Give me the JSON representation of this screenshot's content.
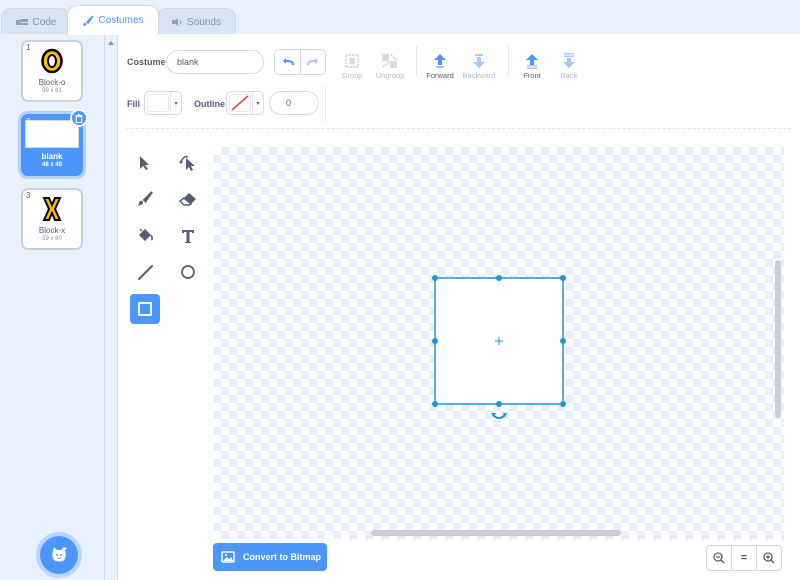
{
  "tabs": [
    {
      "label": "Code",
      "icon": "code-icon"
    },
    {
      "label": "Costumes",
      "icon": "brush-icon"
    },
    {
      "label": "Sounds",
      "icon": "speaker-icon"
    }
  ],
  "costumes": [
    {
      "number": "1",
      "name": "Block-o",
      "size": "99 x 81"
    },
    {
      "number": "2",
      "name": "blank",
      "size": "48 x 48"
    },
    {
      "number": "3",
      "name": "Block-x",
      "size": "59 x 80"
    }
  ],
  "toolbar": {
    "costume_label": "Costume",
    "costume_name": "blank",
    "group": "Group",
    "ungroup": "Ungroup",
    "forward": "Forward",
    "backward": "Backward",
    "front": "Front",
    "back": "Back",
    "fill_label": "Fill",
    "outline_label": "Outline",
    "outline_width": "0"
  },
  "convert_button": "Convert to Bitmap",
  "zoom": {
    "reset": "="
  },
  "colors": {
    "accent": "#4c97ff",
    "selection": "#1d95d8",
    "text": "#575e75"
  }
}
